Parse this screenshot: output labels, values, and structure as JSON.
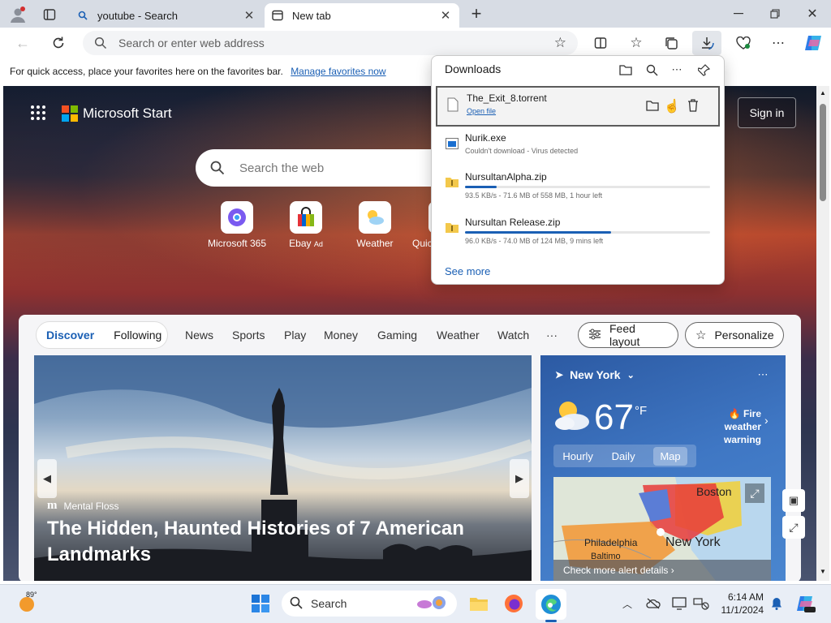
{
  "tabs": [
    {
      "label": "youtube - Search",
      "icon": "search-icon"
    },
    {
      "label": "New tab",
      "icon": "new-tab-icon"
    }
  ],
  "address_bar": {
    "placeholder": "Search or enter web address"
  },
  "favorites_bar": {
    "text": "For quick access, place your favorites here on the favorites bar.",
    "link": "Manage favorites now"
  },
  "downloads": {
    "title": "Downloads",
    "items": [
      {
        "name": "The_Exit_8.torrent",
        "status": "Open file",
        "icon": "file-icon"
      },
      {
        "name": "Nurik.exe",
        "status": "Couldn't download - Virus detected",
        "icon": "exe-icon"
      },
      {
        "name": "NursultanAlpha.zip",
        "status": "93.5 KB/s - 71.6 MB of 558 MB, 1 hour left",
        "progress": 0.128,
        "icon": "zip-folder-icon"
      },
      {
        "name": "Nursultan Release.zip",
        "status": "96.0 KB/s - 74.0 MB of 124 MB, 9 mins left",
        "progress": 0.597,
        "icon": "zip-folder-icon"
      }
    ],
    "see_more": "See more"
  },
  "start": {
    "logo": "Microsoft Start",
    "sign_in": "Sign in",
    "search_placeholder": "Search the web",
    "quick_links": [
      {
        "label": "Microsoft 365"
      },
      {
        "label": "Ebay",
        "ad": "Ad"
      },
      {
        "label": "Weather"
      },
      {
        "label": "Quic"
      }
    ],
    "feed_tabs": {
      "discover": "Discover",
      "following": "Following"
    },
    "nav": [
      "News",
      "Sports",
      "Play",
      "Money",
      "Gaming",
      "Weather",
      "Watch",
      "···"
    ],
    "feed_layout": "Feed layout",
    "personalize": "Personalize",
    "hero": {
      "source": "Mental Floss",
      "headline": "The Hidden, Haunted Histories of 7 American Landmarks"
    },
    "weather": {
      "location": "New York",
      "temp": "67",
      "unit": "°F",
      "alert_line1": "Fire weather",
      "alert_line2": "warning",
      "tabs": [
        "Hourly",
        "Daily",
        "Map"
      ],
      "map_labels": {
        "boston": "Boston",
        "philadelphia": "Philadelphia",
        "new_york": "New York",
        "baltimore": "Baltimo"
      },
      "alert_details": "Check more alert details"
    }
  },
  "taskbar": {
    "temperature": "89°",
    "search": "Search",
    "time": "6:14 AM",
    "date": "11/1/2024"
  }
}
